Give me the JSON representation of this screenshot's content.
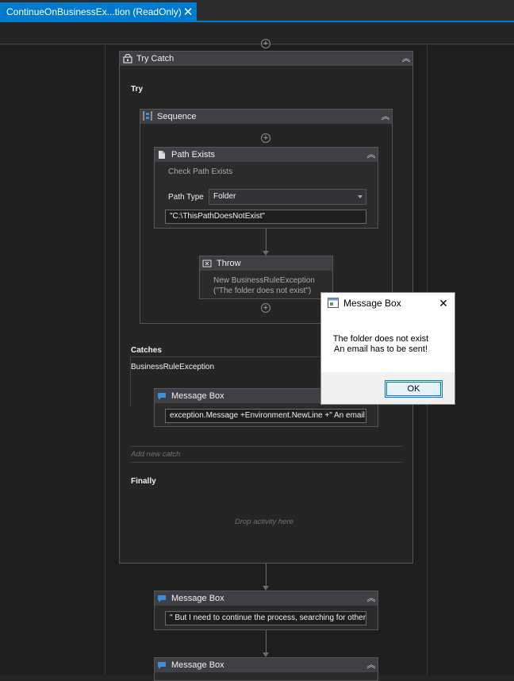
{
  "tab": {
    "title": "ContinueOnBusinessEx...tion (ReadOnly)",
    "close_glyph": "✕"
  },
  "icons": {
    "collapse": "︽",
    "plus": "+"
  },
  "try_catch": {
    "title": "Try Catch",
    "try_label": "Try",
    "sequence": {
      "title": "Sequence",
      "path_exists": {
        "title": "Path Exists",
        "subtitle": "Check Path Exists",
        "path_type_label": "Path Type",
        "path_type_value": "Folder",
        "path_value": "\"C:\\ThisPathDoesNotExist\""
      },
      "throw": {
        "title": "Throw",
        "line1": "New BusinessRuleException",
        "line2": "(\"The folder does not exist\")"
      }
    },
    "catches_label": "Catches",
    "exception_type": "BusinessRuleException",
    "catch_message_box": {
      "title": "Message Box",
      "value": "exception.Message +Environment.NewLine +\" An email has to be sent!\""
    },
    "add_new_catch": "Add new catch",
    "finally_label": "Finally",
    "drop_hint": "Drop activity here"
  },
  "message_box_2": {
    "title": "Message Box",
    "value": "\" But I need to continue the process, searching for other files\""
  },
  "message_box_3": {
    "title": "Message Box"
  },
  "dialog": {
    "title": "Message Box",
    "close_glyph": "✕",
    "line1": "The folder does not exist",
    "line2": "An email has to be sent!",
    "ok_label": "OK"
  }
}
